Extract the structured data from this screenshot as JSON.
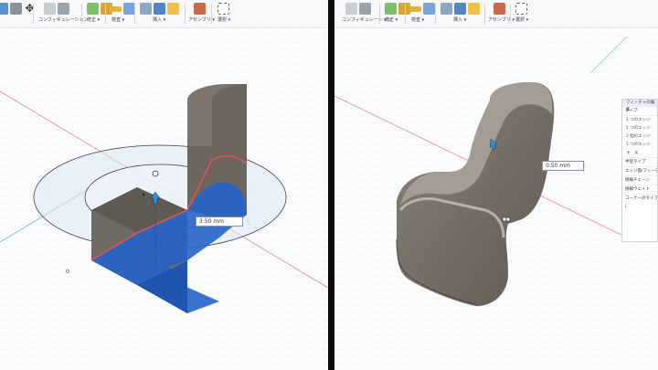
{
  "left_toolbar": {
    "config_label": "コンフィギュレーション",
    "modify_label": "修正 ▾",
    "inspect_label": "検査 ▾",
    "insert_label": "挿入 ▾",
    "assemble_label": "アセンブリ ▾",
    "select_label": "選択 ▾"
  },
  "right_toolbar": {
    "config_label": "コンフィギュレーション",
    "modify_label": "修正 ▾",
    "inspect_label": "検査 ▾",
    "insert_label": "挿入 ▾",
    "assemble_label": "アセンブリ ▾",
    "select_label": "選択 ▾"
  },
  "left_viewport": {
    "dimension_value": "3.50 mm"
  },
  "right_viewport": {
    "dimension_value": "0.50 mm"
  },
  "feature_panel": {
    "title": "フィーチャの編集",
    "type_label": "タイプ",
    "edges": [
      "1 つのエッジ",
      "1 つのエッジ",
      "2 個のエッジ",
      "1 つのエッジ",
      "1 つのエッジ"
    ],
    "add_icon": "+",
    "remove_icon": "×",
    "rows": [
      "半径タイプ",
      "エッジ面/フィーチャ",
      "接線チェーン",
      "接線ウェイト",
      "コーナーのタイプ"
    ],
    "info_icon": "i"
  },
  "colors": {
    "accent_blue": "#2563c9",
    "body_gray": "#6f6a63",
    "selected_edge": "#e0535a",
    "grid": "#e3e7eb"
  }
}
